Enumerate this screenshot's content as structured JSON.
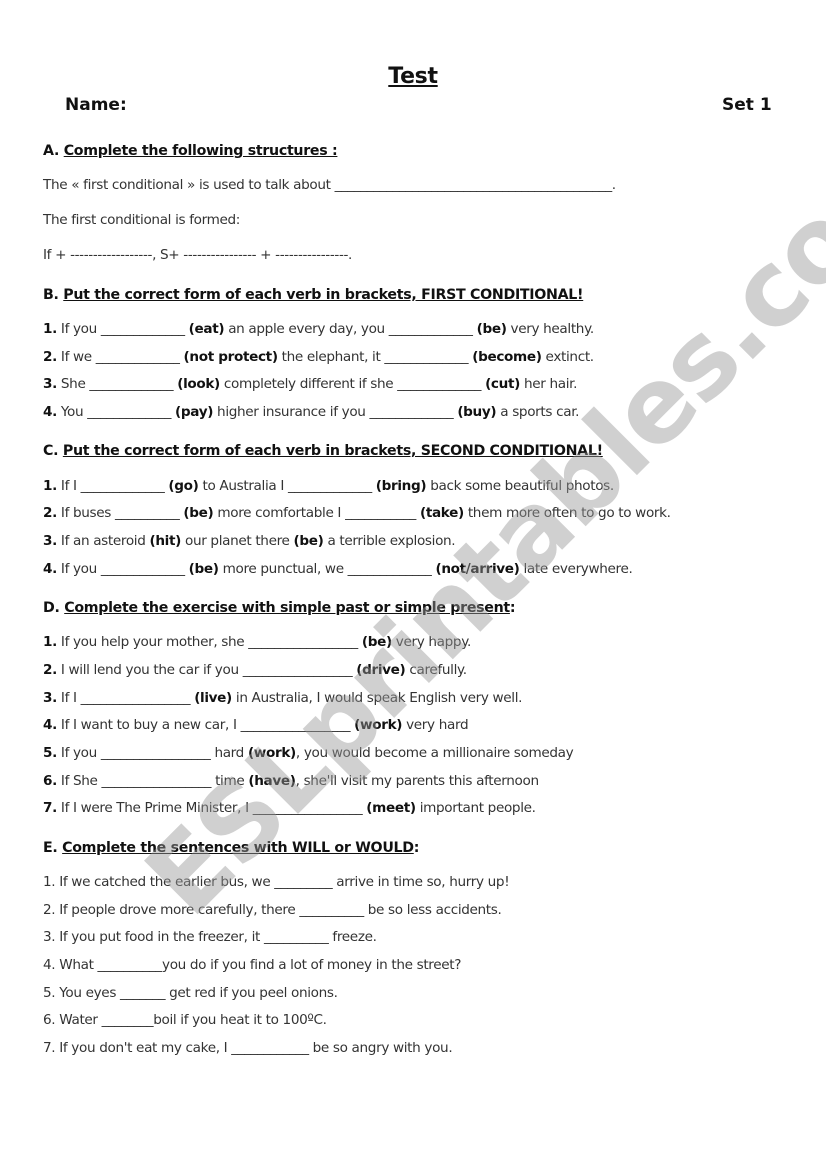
{
  "header": {
    "title": "Test",
    "name_label": "Name:",
    "set_label": "Set 1"
  },
  "watermark": "ESLprintables.com",
  "sectionA": {
    "letter": "A.",
    "heading": "Complete the following structures :",
    "lines": [
      "The « first conditional » is used to talk about ___________________________________________.",
      "The first conditional is formed:",
      "If + ------------------, S+ ---------------- + ----------------."
    ]
  },
  "sectionB": {
    "letter": "B.",
    "heading": "Put the correct form of each verb in brackets, FIRST CONDITIONAL!",
    "items": [
      {
        "num": "1.",
        "p1": " If you _____________ ",
        "v1": "(eat)",
        "p2": " an apple every day, you _____________ ",
        "v2": "(be)",
        "p3": " very healthy."
      },
      {
        "num": "2.",
        "p1": " If we _____________ ",
        "v1": "(not protect)",
        "p2": " the elephant, it _____________ ",
        "v2": "(become)",
        "p3": " extinct."
      },
      {
        "num": "3.",
        "p1": " She _____________ ",
        "v1": "(look)",
        "p2": " completely different if she _____________ ",
        "v2": "(cut)",
        "p3": " her hair."
      },
      {
        "num": "4.",
        "p1": " You _____________ ",
        "v1": "(pay)",
        "p2": " higher insurance if you _____________ ",
        "v2": "(buy)",
        "p3": " a sports car."
      }
    ]
  },
  "sectionC": {
    "letter": "C.",
    "heading": "Put the correct form of each verb in brackets, SECOND CONDITIONAL!",
    "items": [
      {
        "num": "1.",
        "p1": " If I _____________ ",
        "v1": "(go)",
        "p2": " to Australia I _____________ ",
        "v2": "(bring)",
        "p3": " back some beautiful photos."
      },
      {
        "num": "2.",
        "p1": " If buses __________ ",
        "v1": "(be)",
        "p2": " more comfortable I ___________ ",
        "v2": "(take)",
        "p3": " them more often to go to work."
      },
      {
        "num": "3.",
        "p1": " If an asteroid ",
        "v1": "(hit)",
        "p2": " our planet there ",
        "v2": "(be)",
        "p3": " a terrible explosion."
      },
      {
        "num": "4.",
        "p1": " If you _____________ ",
        "v1": "(be)",
        "p2": " more punctual, we _____________ ",
        "v2": "(not/arrive)",
        "p3": " late everywhere."
      }
    ]
  },
  "sectionD": {
    "letter": "D.",
    "heading": "Complete the exercise with simple past or simple present",
    "heading_suffix": ":",
    "items": [
      {
        "num": "1.",
        "p1": " If you help your mother, she _________________ ",
        "v1": "(be)",
        "p2": " very happy."
      },
      {
        "num": "2.",
        "p1": " I will lend you the car if you _________________ ",
        "v1": "(drive)",
        "p2": " carefully."
      },
      {
        "num": "3.",
        "p1": " If I _________________ ",
        "v1": "(live)",
        "p2": " in Australia, I would speak English very well."
      },
      {
        "num": "4.",
        "p1": " If I want to buy a new car, I _________________ ",
        "v1": "(work)",
        "p2": " very hard"
      },
      {
        "num": "5.",
        "p1": " If you _________________ hard ",
        "v1": "(work)",
        "p2": ", you would become a millionaire someday"
      },
      {
        "num": "6.",
        "p1": " If She _________________ time ",
        "v1": "(have)",
        "p2": ", she'll visit my parents this afternoon"
      },
      {
        "num": "7.",
        "p1": " If I were The Prime Minister, I _________________ ",
        "v1": "(meet)",
        "p2": " important people."
      }
    ]
  },
  "sectionE": {
    "letter": "E.",
    "heading": "Complete the sentences with WILL or WOULD",
    "heading_suffix": ":",
    "items": [
      "1. If we catched the earlier bus, we _________ arrive in time so, hurry up!",
      "2. If people drove more carefully, there __________ be so less accidents.",
      "3. If you put food in the freezer, it __________ freeze.",
      "4. What __________you do if you find a lot of money in the street?",
      "5. You eyes _______ get red if you peel onions.",
      "6. Water ________boil if you heat it to 100ºC.",
      "7. If you don't eat my cake, I ____________ be so angry with you."
    ]
  }
}
